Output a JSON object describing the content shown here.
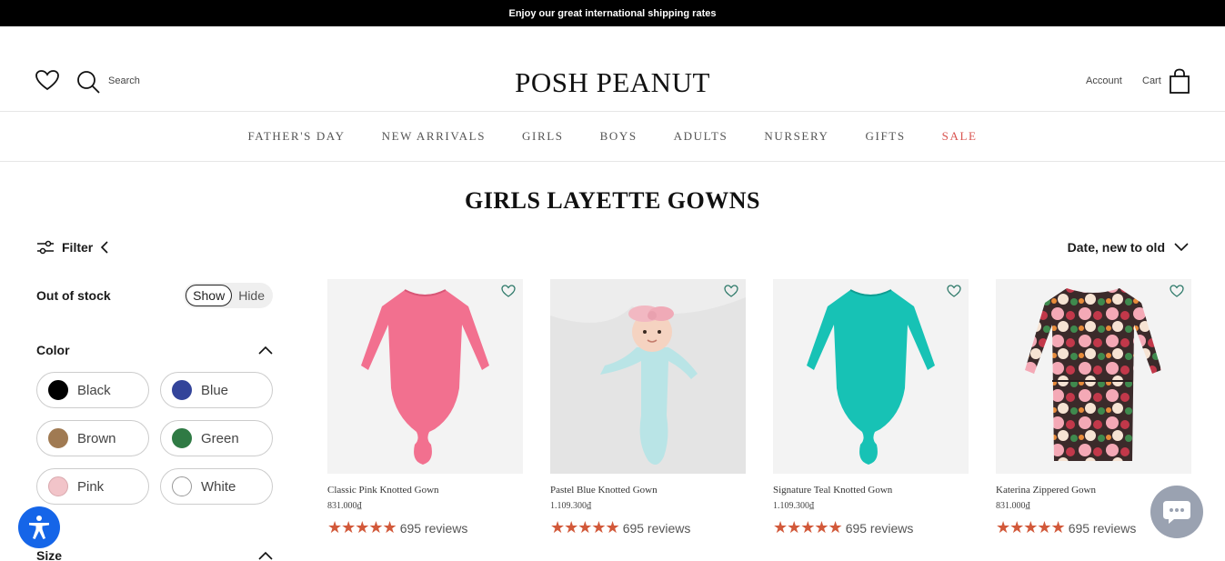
{
  "announcement": "Enjoy our great international shipping rates",
  "header": {
    "search_label": "Search",
    "logo": "POSH PEANUT",
    "account_label": "Account",
    "cart_label": "Cart"
  },
  "nav": {
    "items": [
      {
        "label": "FATHER'S DAY"
      },
      {
        "label": "NEW ARRIVALS"
      },
      {
        "label": "GIRLS"
      },
      {
        "label": "BOYS"
      },
      {
        "label": "ADULTS"
      },
      {
        "label": "NURSERY"
      },
      {
        "label": "GIFTS"
      },
      {
        "label": "SALE"
      }
    ]
  },
  "page_title": "GIRLS LAYETTE GOWNS",
  "filter": {
    "label": "Filter",
    "out_of_stock_label": "Out of stock",
    "toggle_show": "Show",
    "toggle_hide": "Hide",
    "color_label": "Color",
    "size_label": "Size",
    "colors": [
      {
        "name": "Black",
        "hex": "#000000"
      },
      {
        "name": "Blue",
        "hex": "#33449a"
      },
      {
        "name": "Brown",
        "hex": "#a07a52"
      },
      {
        "name": "Green",
        "hex": "#2f7a44"
      },
      {
        "name": "Pink",
        "hex": "#f2c4c9"
      },
      {
        "name": "White",
        "hex": "#ffffff"
      }
    ]
  },
  "sort": {
    "label": "Date, new to old"
  },
  "products": [
    {
      "name": "Classic Pink Knotted Gown",
      "price": "831.000₫",
      "reviews": "695 reviews",
      "color": "#f2708f"
    },
    {
      "name": "Pastel Blue Knotted Gown",
      "price": "1.109.300₫",
      "reviews": "695 reviews",
      "color": "#b9e4e6"
    },
    {
      "name": "Signature Teal Knotted Gown",
      "price": "1.109.300₫",
      "reviews": "695 reviews",
      "color": "#17c2b5"
    },
    {
      "name": "Katerina Zippered Gown",
      "price": "831.000₫",
      "reviews": "695 reviews",
      "color": "#c2384a"
    }
  ],
  "colors": {
    "sale": "#d9534f",
    "star": "#d2593a",
    "accessibility": "#1565e8"
  }
}
